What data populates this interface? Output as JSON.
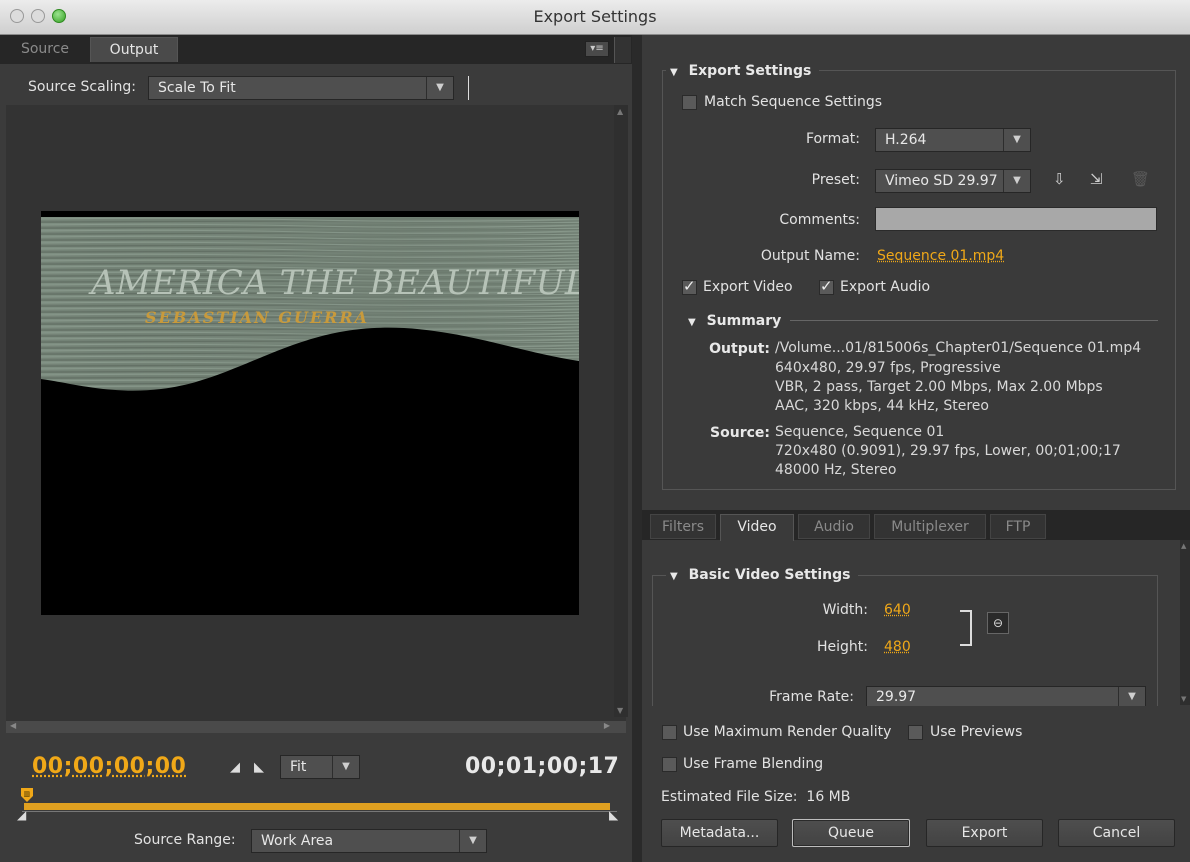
{
  "window": {
    "title": "Export Settings"
  },
  "left": {
    "tabs": [
      "Source",
      "Output"
    ],
    "active_tab": "Output",
    "source_scaling": {
      "label": "Source Scaling:",
      "value": "Scale To Fit"
    },
    "video": {
      "title_line": "AMERICA THE BEAUTIFUL",
      "subtitle_line": "SEBASTIAN GUERRA"
    },
    "timecode_in": "00;00;00;00",
    "timecode_out": "00;01;00;17",
    "zoom": "Fit",
    "source_range": {
      "label": "Source Range:",
      "value": "Work Area"
    }
  },
  "export_settings": {
    "section_title": "Export Settings",
    "match_sequence_label": "Match Sequence Settings",
    "format_label": "Format:",
    "format_value": "H.264",
    "preset_label": "Preset:",
    "preset_value": "Vimeo SD 29.97",
    "comments_label": "Comments:",
    "comments_value": "",
    "output_name_label": "Output Name:",
    "output_name_value": "Sequence 01.mp4",
    "export_video_label": "Export Video",
    "export_audio_label": "Export Audio",
    "summary_title": "Summary",
    "output_label": "Output:",
    "output_lines": [
      "/Volume...01/815006s_Chapter01/Sequence 01.mp4",
      "640x480, 29.97 fps, Progressive",
      "VBR, 2 pass, Target 2.00 Mbps, Max 2.00 Mbps",
      "AAC, 320 kbps, 44 kHz, Stereo"
    ],
    "source_label": "Source:",
    "source_lines": [
      "Sequence, Sequence 01",
      "720x480 (0.9091), 29.97 fps, Lower, 00;01;00;17",
      "48000 Hz, Stereo"
    ]
  },
  "settings_tabs": [
    "Filters",
    "Video",
    "Audio",
    "Multiplexer",
    "FTP"
  ],
  "active_settings_tab": "Video",
  "basic_video": {
    "title": "Basic Video Settings",
    "width_label": "Width:",
    "width_value": "640",
    "height_label": "Height:",
    "height_value": "480",
    "frame_rate_label": "Frame Rate:",
    "frame_rate_value": "29.97"
  },
  "bottom": {
    "max_render_label": "Use Maximum Render Quality",
    "use_previews_label": "Use Previews",
    "frame_blending_label": "Use Frame Blending",
    "estimated_size": "Estimated File Size:  16 MB",
    "buttons": {
      "metadata": "Metadata...",
      "queue": "Queue",
      "export": "Export",
      "cancel": "Cancel"
    }
  },
  "colors": {
    "accent": "#f0a818",
    "panel": "#3a3a3a",
    "dark": "#262626"
  }
}
